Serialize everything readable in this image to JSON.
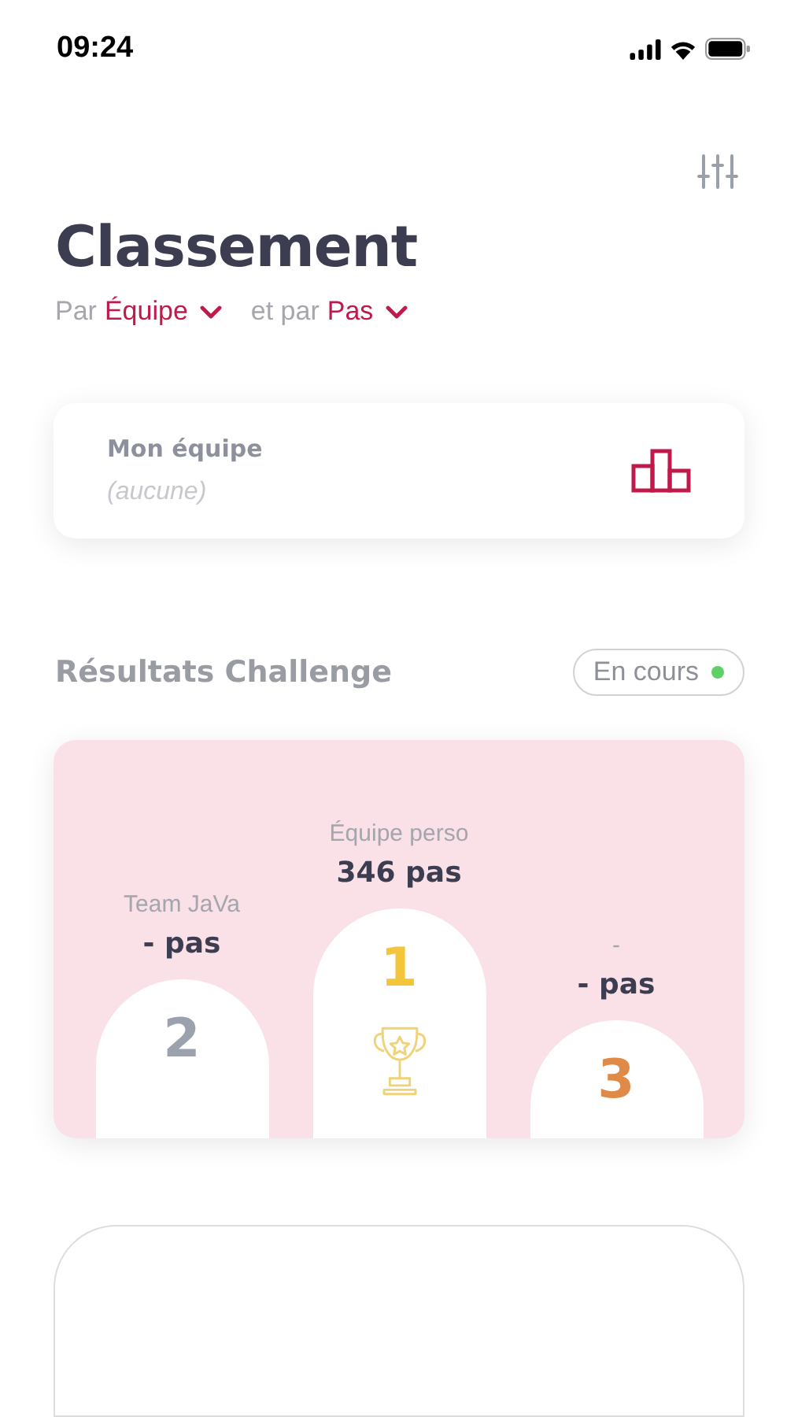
{
  "status_bar": {
    "time": "09:24"
  },
  "title": "Classement",
  "filters": [
    {
      "prefix": "Par",
      "value": "Équipe"
    },
    {
      "prefix": "et par",
      "value": "Pas"
    }
  ],
  "my_team": {
    "label": "Mon équipe",
    "value": "(aucune)"
  },
  "results": {
    "title": "Résultats Challenge",
    "status": "En cours",
    "podium": [
      {
        "name": "Team JaVa",
        "steps": "- pas",
        "rank": "2",
        "color": "#9ca1ae",
        "kind": "medium",
        "trophy": false
      },
      {
        "name": "Équipe perso",
        "steps": "346 pas",
        "rank": "1",
        "color": "#f3c53a",
        "kind": "tall",
        "trophy": true
      },
      {
        "name": "-",
        "steps": "- pas",
        "rank": "3",
        "color": "#e08a47",
        "kind": "short",
        "trophy": false
      }
    ]
  }
}
